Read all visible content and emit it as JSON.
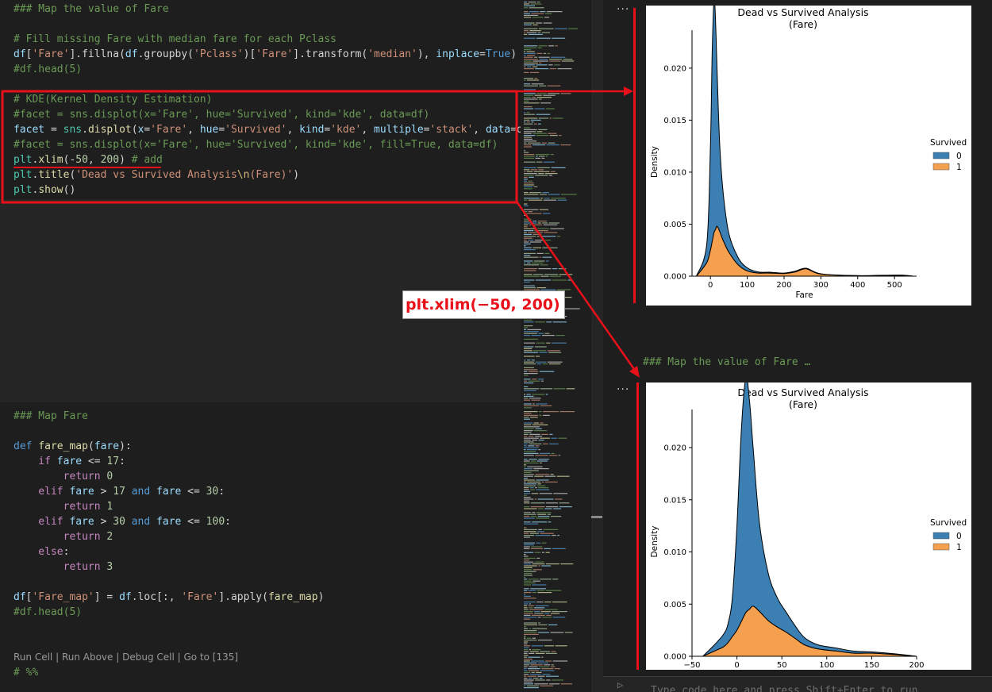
{
  "code_cell_1": {
    "lines": [
      [
        {
          "t": "### Map the value of Fare",
          "c": "#6a9955"
        }
      ],
      [],
      [
        {
          "t": "# Fill missing Fare with median fare for each Pclass",
          "c": "#6a9955"
        }
      ],
      [
        {
          "t": "df",
          "c": "#9cdcfe"
        },
        {
          "t": "[",
          "c": "#d4d4d4"
        },
        {
          "t": "'Fare'",
          "c": "#ce9178"
        },
        {
          "t": "].fillna(",
          "c": "#d4d4d4"
        },
        {
          "t": "df",
          "c": "#9cdcfe"
        },
        {
          "t": ".groupby(",
          "c": "#d4d4d4"
        },
        {
          "t": "'Pclass'",
          "c": "#ce9178"
        },
        {
          "t": ")[",
          "c": "#d4d4d4"
        },
        {
          "t": "'Fare'",
          "c": "#ce9178"
        },
        {
          "t": "].transform(",
          "c": "#d4d4d4"
        },
        {
          "t": "'median'",
          "c": "#ce9178"
        },
        {
          "t": "), ",
          "c": "#d4d4d4"
        },
        {
          "t": "inplace",
          "c": "#9cdcfe"
        },
        {
          "t": "=",
          "c": "#d4d4d4"
        },
        {
          "t": "True",
          "c": "#569cd6"
        },
        {
          "t": ")",
          "c": "#d4d4d4"
        }
      ],
      [
        {
          "t": "#df.head(5)",
          "c": "#6a9955"
        }
      ],
      [],
      [
        {
          "t": "# KDE(Kernel Density Estimation)",
          "c": "#6a9955"
        }
      ],
      [
        {
          "t": "#facet = sns.displot(x='Fare', hue='Survived', kind='kde', data=df)",
          "c": "#6a9955"
        }
      ],
      [
        {
          "t": "facet",
          "c": "#9cdcfe"
        },
        {
          "t": " = ",
          "c": "#d4d4d4"
        },
        {
          "t": "sns",
          "c": "#4ec9b0"
        },
        {
          "t": ".",
          "c": "#d4d4d4"
        },
        {
          "t": "displot",
          "c": "#dcdcaa"
        },
        {
          "t": "(",
          "c": "#d4d4d4"
        },
        {
          "t": "x",
          "c": "#9cdcfe"
        },
        {
          "t": "=",
          "c": "#d4d4d4"
        },
        {
          "t": "'Fare'",
          "c": "#ce9178"
        },
        {
          "t": ", ",
          "c": "#d4d4d4"
        },
        {
          "t": "hue",
          "c": "#9cdcfe"
        },
        {
          "t": "=",
          "c": "#d4d4d4"
        },
        {
          "t": "'Survived'",
          "c": "#ce9178"
        },
        {
          "t": ", ",
          "c": "#d4d4d4"
        },
        {
          "t": "kind",
          "c": "#9cdcfe"
        },
        {
          "t": "=",
          "c": "#d4d4d4"
        },
        {
          "t": "'kde'",
          "c": "#ce9178"
        },
        {
          "t": ", ",
          "c": "#d4d4d4"
        },
        {
          "t": "multiple",
          "c": "#9cdcfe"
        },
        {
          "t": "=",
          "c": "#d4d4d4"
        },
        {
          "t": "'stack'",
          "c": "#ce9178"
        },
        {
          "t": ", ",
          "c": "#d4d4d4"
        },
        {
          "t": "data",
          "c": "#9cdcfe"
        },
        {
          "t": "=d",
          "c": "#d4d4d4"
        }
      ],
      [
        {
          "t": "#facet = sns.displot(x='Fare', hue='Survived', kind='kde', fill=True, data=df)",
          "c": "#6a9955"
        }
      ],
      [
        {
          "t": "plt",
          "c": "#4ec9b0"
        },
        {
          "t": ".",
          "c": "#d4d4d4"
        },
        {
          "t": "xlim",
          "c": "#dcdcaa"
        },
        {
          "t": "(-",
          "c": "#d4d4d4"
        },
        {
          "t": "50",
          "c": "#b5cea8"
        },
        {
          "t": ", ",
          "c": "#d4d4d4"
        },
        {
          "t": "200",
          "c": "#b5cea8"
        },
        {
          "t": ") ",
          "c": "#d4d4d4"
        },
        {
          "t": "# add",
          "c": "#6a9955"
        }
      ],
      [
        {
          "t": "plt",
          "c": "#4ec9b0"
        },
        {
          "t": ".",
          "c": "#d4d4d4"
        },
        {
          "t": "title",
          "c": "#dcdcaa"
        },
        {
          "t": "(",
          "c": "#d4d4d4"
        },
        {
          "t": "'Dead vs Survived Analysis",
          "c": "#ce9178"
        },
        {
          "t": "\\n",
          "c": "#d7ba7d"
        },
        {
          "t": "(Fare)'",
          "c": "#ce9178"
        },
        {
          "t": ")",
          "c": "#d4d4d4"
        }
      ],
      [
        {
          "t": "plt",
          "c": "#4ec9b0"
        },
        {
          "t": ".",
          "c": "#d4d4d4"
        },
        {
          "t": "show",
          "c": "#dcdcaa"
        },
        {
          "t": "()",
          "c": "#d4d4d4"
        }
      ]
    ]
  },
  "code_cell_2": {
    "lines": [
      [
        {
          "t": "### Map Fare",
          "c": "#6a9955"
        }
      ],
      [],
      [
        {
          "t": "def ",
          "c": "#569cd6"
        },
        {
          "t": "fare_map",
          "c": "#dcdcaa"
        },
        {
          "t": "(",
          "c": "#d4d4d4"
        },
        {
          "t": "fare",
          "c": "#9cdcfe"
        },
        {
          "t": "):",
          "c": "#d4d4d4"
        }
      ],
      [
        {
          "t": "    if ",
          "c": "#c586c0"
        },
        {
          "t": "fare",
          "c": "#9cdcfe"
        },
        {
          "t": " <= ",
          "c": "#d4d4d4"
        },
        {
          "t": "17",
          "c": "#b5cea8"
        },
        {
          "t": ":",
          "c": "#d4d4d4"
        }
      ],
      [
        {
          "t": "        return ",
          "c": "#c586c0"
        },
        {
          "t": "0",
          "c": "#b5cea8"
        }
      ],
      [
        {
          "t": "    elif ",
          "c": "#c586c0"
        },
        {
          "t": "fare",
          "c": "#9cdcfe"
        },
        {
          "t": " > ",
          "c": "#d4d4d4"
        },
        {
          "t": "17",
          "c": "#b5cea8"
        },
        {
          "t": " and ",
          "c": "#569cd6"
        },
        {
          "t": "fare",
          "c": "#9cdcfe"
        },
        {
          "t": " <= ",
          "c": "#d4d4d4"
        },
        {
          "t": "30",
          "c": "#b5cea8"
        },
        {
          "t": ":",
          "c": "#d4d4d4"
        }
      ],
      [
        {
          "t": "        return ",
          "c": "#c586c0"
        },
        {
          "t": "1",
          "c": "#b5cea8"
        }
      ],
      [
        {
          "t": "    elif ",
          "c": "#c586c0"
        },
        {
          "t": "fare",
          "c": "#9cdcfe"
        },
        {
          "t": " > ",
          "c": "#d4d4d4"
        },
        {
          "t": "30",
          "c": "#b5cea8"
        },
        {
          "t": " and ",
          "c": "#569cd6"
        },
        {
          "t": "fare",
          "c": "#9cdcfe"
        },
        {
          "t": " <= ",
          "c": "#d4d4d4"
        },
        {
          "t": "100",
          "c": "#b5cea8"
        },
        {
          "t": ":",
          "c": "#d4d4d4"
        }
      ],
      [
        {
          "t": "        return ",
          "c": "#c586c0"
        },
        {
          "t": "2",
          "c": "#b5cea8"
        }
      ],
      [
        {
          "t": "    else",
          "c": "#c586c0"
        },
        {
          "t": ":",
          "c": "#d4d4d4"
        }
      ],
      [
        {
          "t": "        return ",
          "c": "#c586c0"
        },
        {
          "t": "3",
          "c": "#b5cea8"
        }
      ],
      [],
      [
        {
          "t": "df",
          "c": "#9cdcfe"
        },
        {
          "t": "[",
          "c": "#d4d4d4"
        },
        {
          "t": "'Fare_map'",
          "c": "#ce9178"
        },
        {
          "t": "] = ",
          "c": "#d4d4d4"
        },
        {
          "t": "df",
          "c": "#9cdcfe"
        },
        {
          "t": ".loc[:, ",
          "c": "#d4d4d4"
        },
        {
          "t": "'Fare'",
          "c": "#ce9178"
        },
        {
          "t": "].apply(",
          "c": "#d4d4d4"
        },
        {
          "t": "fare_map",
          "c": "#dcdcaa"
        },
        {
          "t": ")",
          "c": "#d4d4d4"
        }
      ],
      [
        {
          "t": "#df.head(5)",
          "c": "#6a9955"
        }
      ]
    ]
  },
  "cell_toolbar": {
    "run_cell": "Run Cell",
    "run_above": "Run Above",
    "debug_cell": "Debug Cell",
    "go_to": "Go to [135]",
    "separator": " | "
  },
  "next_cell_marker": "# %%",
  "interactive": {
    "more_label": "...",
    "markdown_header": "### Map the value of Fare …",
    "input_placeholder": "Type code here and press Shift+Enter to run"
  },
  "annotation_label": "plt.xlim(−50, 200)",
  "colors": {
    "survived_0": "#3b7fb3",
    "survived_1": "#f4a04f",
    "annotation_red": "#e8111a"
  },
  "chart_data": [
    {
      "type": "area",
      "stacked": true,
      "title": "Dead vs Survived Analysis\n(Fare)",
      "xlabel": "Fare",
      "ylabel": "Density",
      "xlim": [
        -50,
        560
      ],
      "ylim": [
        0,
        0.0235
      ],
      "xticks": [
        0,
        100,
        200,
        300,
        400,
        500
      ],
      "yticks": [
        0.0,
        0.005,
        0.01,
        0.015,
        0.02
      ],
      "ytick_labels": [
        "0.000",
        "0.005",
        "0.010",
        "0.015",
        "0.020"
      ],
      "legend": {
        "title": "Survived",
        "entries": [
          "0",
          "1"
        ],
        "placement": "center-right"
      },
      "series": [
        {
          "name": "0",
          "color": "#3b7fb3",
          "x": [
            -38,
            -10,
            0,
            5,
            10,
            14,
            18,
            25,
            35,
            50,
            75,
            100,
            130,
            160,
            200,
            230,
            260,
            300,
            400,
            512,
            550
          ],
          "y": [
            0.0002,
            0.0018,
            0.01,
            0.0185,
            0.0225,
            0.02,
            0.0152,
            0.0085,
            0.0045,
            0.0018,
            0.0007,
            0.0003,
            0.0001,
            8e-05,
            5e-05,
            8e-05,
            6e-05,
            3e-05,
            1e-05,
            3e-05,
            1e-05
          ]
        },
        {
          "name": "1",
          "color": "#f4a04f",
          "x": [
            -38,
            -10,
            0,
            10,
            18,
            25,
            35,
            50,
            75,
            100,
            130,
            160,
            200,
            230,
            260,
            300,
            400,
            512,
            550
          ],
          "y": [
            0.0002,
            0.0013,
            0.0025,
            0.0042,
            0.0048,
            0.0043,
            0.0034,
            0.0023,
            0.0011,
            0.0005,
            0.0003,
            0.0003,
            0.00025,
            0.0004,
            0.0007,
            0.0002,
            4e-05,
            8e-05,
            2e-05
          ]
        }
      ]
    },
    {
      "type": "area",
      "stacked": true,
      "title": "Dead vs Survived Analysis\n(Fare)",
      "xlabel": "",
      "ylabel": "Density",
      "xlim": [
        -50,
        200
      ],
      "ylim": [
        0,
        0.0235
      ],
      "xticks": [
        -50,
        0,
        50,
        100,
        150,
        200
      ],
      "xtick_labels": [
        "−50",
        "0",
        "50",
        "100",
        "150",
        "200"
      ],
      "yticks": [
        0.0,
        0.005,
        0.01,
        0.015,
        0.02
      ],
      "ytick_labels": [
        "0.000",
        "0.005",
        "0.010",
        "0.015",
        "0.020"
      ],
      "legend": {
        "title": "Survived",
        "entries": [
          "0",
          "1"
        ],
        "placement": "center-right"
      },
      "series": [
        {
          "name": "0",
          "color": "#3b7fb3",
          "x": [
            -38,
            -25,
            -15,
            -10,
            -5,
            0,
            5,
            10,
            14,
            18,
            25,
            35,
            45,
            55,
            65,
            75,
            90,
            110,
            130,
            150,
            170,
            185,
            200
          ],
          "y": [
            0.0002,
            0.0006,
            0.0012,
            0.0018,
            0.0038,
            0.01,
            0.0185,
            0.0225,
            0.02,
            0.0152,
            0.0085,
            0.0045,
            0.0028,
            0.0019,
            0.0012,
            0.0007,
            0.0004,
            0.0003,
            0.0002,
            0.00012,
            8e-05,
            5e-05,
            3e-05
          ]
        },
        {
          "name": "1",
          "color": "#f4a04f",
          "x": [
            -38,
            -25,
            -15,
            -10,
            -5,
            0,
            10,
            18,
            25,
            35,
            45,
            55,
            65,
            75,
            90,
            110,
            130,
            150,
            170,
            185,
            200
          ],
          "y": [
            0.0002,
            0.0005,
            0.0009,
            0.0013,
            0.0019,
            0.0025,
            0.0042,
            0.0048,
            0.0043,
            0.0034,
            0.0028,
            0.0023,
            0.0017,
            0.0011,
            0.0007,
            0.0005,
            0.0003,
            0.0003,
            0.0002,
            0.0001,
            5e-05
          ]
        }
      ]
    }
  ]
}
